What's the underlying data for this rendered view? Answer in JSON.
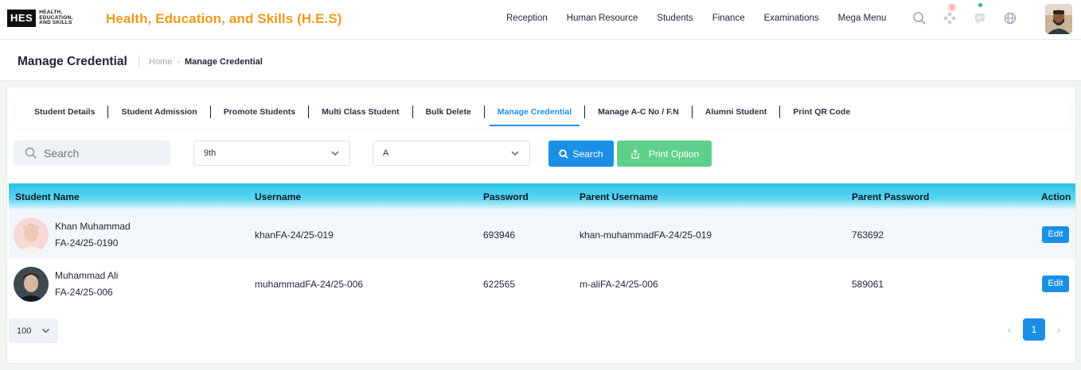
{
  "logo": {
    "mark": "HES",
    "text_line1": "HEALTH,",
    "text_line2": "EDUCATION,",
    "text_line3": "AND SKILLS"
  },
  "app_title": "Health, Education, and Skills (H.E.S)",
  "topnav": [
    "Reception",
    "Human Resource",
    "Students",
    "Finance",
    "Examinations",
    "Mega Menu"
  ],
  "notifications_badge": "0",
  "page_title": "Manage Credential",
  "breadcrumb": {
    "home": "Home",
    "separator": "-",
    "current": "Manage Credential"
  },
  "tabs": [
    {
      "label": "Student Details",
      "active": false
    },
    {
      "label": "Student Admission",
      "active": false
    },
    {
      "label": "Promote Students",
      "active": false
    },
    {
      "label": "Multi Class Student",
      "active": false
    },
    {
      "label": "Bulk Delete",
      "active": false
    },
    {
      "label": "Manage Credential",
      "active": true
    },
    {
      "label": "Manage A-C No / F.N",
      "active": false
    },
    {
      "label": "Alumni Student",
      "active": false
    },
    {
      "label": "Print QR Code",
      "active": false
    }
  ],
  "filters": {
    "search_placeholder": "Search",
    "class_value": "9th",
    "section_value": "A",
    "search_button": "Search",
    "print_button": "Print Option"
  },
  "table": {
    "headers": [
      "Student Name",
      "Username",
      "Password",
      "Parent Username",
      "Parent Password",
      "Action"
    ],
    "rows": [
      {
        "name": "Khan Muhammad",
        "id": "FA-24/25-0190",
        "username": "khanFA-24/25-019",
        "password": "693946",
        "parent_username": "khan-muhammadFA-24/25-019",
        "parent_password": "763692",
        "action": "Edit"
      },
      {
        "name": "Muhammad Ali",
        "id": "FA-24/25-006",
        "username": "muhammadFA-24/25-006",
        "password": "622565",
        "parent_username": "m-aliFA-24/25-006",
        "parent_password": "589061",
        "action": "Edit"
      }
    ]
  },
  "pagination": {
    "page_size": "100",
    "current_page": "1",
    "prev": "‹",
    "next": "›"
  },
  "colors": {
    "accent": "#1b8fe6",
    "brand_orange": "#f09a1e",
    "success": "#5fd08a",
    "table_header": "#27c3e8"
  }
}
